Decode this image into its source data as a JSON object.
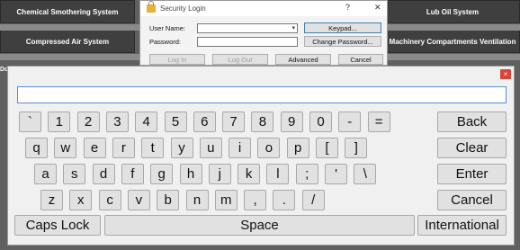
{
  "background": {
    "tiles": [
      {
        "label": "Chemical Smothering System"
      },
      {
        "label": "Lub Oil System"
      },
      {
        "label": "Compressed Air System"
      },
      {
        "label": "Machinery Compartments Ventilation"
      }
    ],
    "edge_label": "Do"
  },
  "login": {
    "title": "Security Login",
    "help_glyph": "?",
    "close_glyph": "✕",
    "username_label": "User Name:",
    "username_value": "",
    "password_label": "Password:",
    "password_value": "",
    "keypad_button": "Keypad...",
    "change_password_button": "Change Password...",
    "login_button": "Log In",
    "logout_button": "Log Out",
    "advanced_button": "Advanced",
    "cancel_button": "Cancel"
  },
  "keypad": {
    "close_glyph": "×",
    "input_value": "",
    "row1": [
      "`",
      "1",
      "2",
      "3",
      "4",
      "5",
      "6",
      "7",
      "8",
      "9",
      "0",
      "-",
      "="
    ],
    "row2": [
      "q",
      "w",
      "e",
      "r",
      "t",
      "y",
      "u",
      "i",
      "o",
      "p",
      "[",
      "]"
    ],
    "row3": [
      "a",
      "s",
      "d",
      "f",
      "g",
      "h",
      "j",
      "k",
      "l",
      ";",
      "'",
      "\\"
    ],
    "row4": [
      "z",
      "x",
      "c",
      "v",
      "b",
      "n",
      "m",
      ",",
      ".",
      "/"
    ],
    "back": "Back",
    "clear": "Clear",
    "enter": "Enter",
    "cancel": "Cancel",
    "caps_lock": "Caps Lock",
    "space": "Space",
    "international": "International"
  }
}
